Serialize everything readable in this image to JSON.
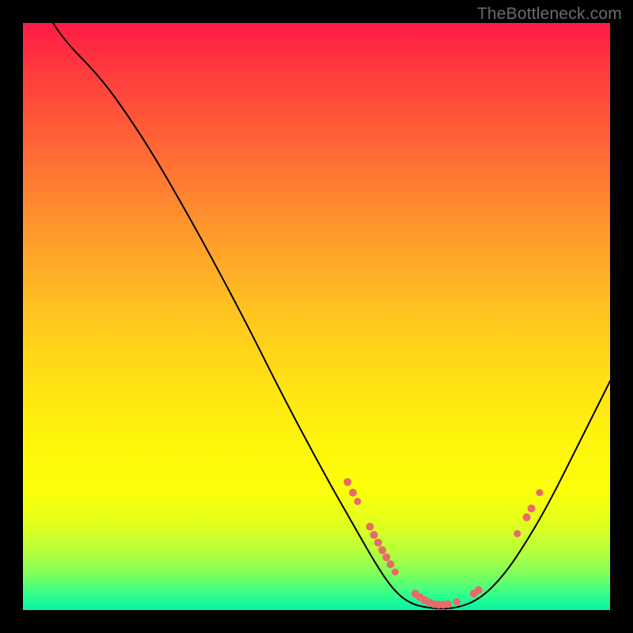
{
  "watermark": "TheBottleneck.com",
  "colors": {
    "marker": "#e86a6a",
    "curve": "#000000"
  },
  "chart_data": {
    "type": "line",
    "title": "",
    "xlabel": "",
    "ylabel": "",
    "xlim": [
      0,
      100
    ],
    "ylim": [
      0,
      100
    ],
    "grid": false,
    "curve": [
      {
        "x": 0.0,
        "y": 110.0
      },
      {
        "x": 2.0,
        "y": 105.5
      },
      {
        "x": 5.0,
        "y": 100.0
      },
      {
        "x": 8.0,
        "y": 96.0
      },
      {
        "x": 12.0,
        "y": 92.0
      },
      {
        "x": 16.0,
        "y": 87.0
      },
      {
        "x": 22.0,
        "y": 78.0
      },
      {
        "x": 30.0,
        "y": 64.0
      },
      {
        "x": 38.0,
        "y": 49.0
      },
      {
        "x": 45.0,
        "y": 35.0
      },
      {
        "x": 52.0,
        "y": 22.0
      },
      {
        "x": 56.0,
        "y": 15.0
      },
      {
        "x": 60.0,
        "y": 8.0
      },
      {
        "x": 63.0,
        "y": 3.5
      },
      {
        "x": 66.0,
        "y": 1.0
      },
      {
        "x": 70.0,
        "y": 0.2
      },
      {
        "x": 74.0,
        "y": 0.3
      },
      {
        "x": 78.0,
        "y": 2.0
      },
      {
        "x": 82.0,
        "y": 6.0
      },
      {
        "x": 86.0,
        "y": 12.0
      },
      {
        "x": 90.0,
        "y": 19.0
      },
      {
        "x": 94.0,
        "y": 27.0
      },
      {
        "x": 98.0,
        "y": 35.0
      },
      {
        "x": 100.0,
        "y": 39.0
      }
    ],
    "markers": [
      {
        "x": 55.3,
        "y": 21.8,
        "r": 5.0
      },
      {
        "x": 56.2,
        "y": 20.0,
        "r": 5.0
      },
      {
        "x": 57.0,
        "y": 18.5,
        "r": 4.5
      },
      {
        "x": 59.1,
        "y": 14.2,
        "r": 5.0
      },
      {
        "x": 59.8,
        "y": 12.8,
        "r": 5.0
      },
      {
        "x": 60.5,
        "y": 11.5,
        "r": 5.0
      },
      {
        "x": 61.2,
        "y": 10.2,
        "r": 5.0
      },
      {
        "x": 61.9,
        "y": 9.0,
        "r": 5.0
      },
      {
        "x": 62.6,
        "y": 7.8,
        "r": 5.0
      },
      {
        "x": 63.4,
        "y": 6.5,
        "r": 4.5
      },
      {
        "x": 66.8,
        "y": 2.8,
        "r": 5.0
      },
      {
        "x": 67.6,
        "y": 2.2,
        "r": 5.0
      },
      {
        "x": 68.4,
        "y": 1.7,
        "r": 5.0
      },
      {
        "x": 69.2,
        "y": 1.3,
        "r": 5.0
      },
      {
        "x": 70.0,
        "y": 1.0,
        "r": 5.0
      },
      {
        "x": 70.8,
        "y": 0.9,
        "r": 5.0
      },
      {
        "x": 71.6,
        "y": 0.9,
        "r": 5.0
      },
      {
        "x": 72.4,
        "y": 1.0,
        "r": 5.0
      },
      {
        "x": 73.9,
        "y": 1.4,
        "r": 4.5
      },
      {
        "x": 76.8,
        "y": 2.8,
        "r": 5.0
      },
      {
        "x": 77.6,
        "y": 3.4,
        "r": 5.0
      },
      {
        "x": 84.2,
        "y": 13.0,
        "r": 4.5
      },
      {
        "x": 85.8,
        "y": 15.8,
        "r": 5.0
      },
      {
        "x": 86.6,
        "y": 17.3,
        "r": 5.0
      },
      {
        "x": 88.0,
        "y": 20.0,
        "r": 4.5
      }
    ]
  }
}
